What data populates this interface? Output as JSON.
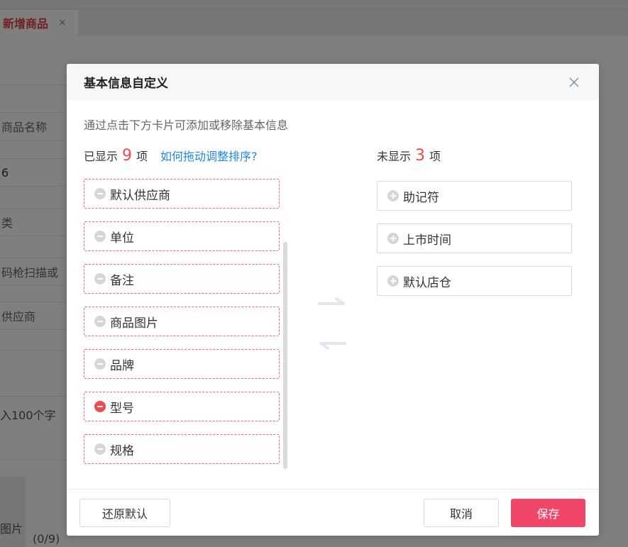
{
  "background": {
    "tab": {
      "label": "新增商品",
      "close": "×"
    },
    "fields": [
      "商品名称",
      "6",
      "类",
      "码枪扫描或",
      "供应商",
      "入100个字",
      "图片"
    ],
    "counter": "(0/9)"
  },
  "modal": {
    "title": "基本信息自定义",
    "description": "通过点击下方卡片可添加或移除基本信息",
    "shown": {
      "label_prefix": "已显示",
      "count": "9",
      "label_suffix": "项",
      "help_link": "如何拖动调整排序?",
      "items": [
        {
          "label": "默认供应商",
          "active": false
        },
        {
          "label": "单位",
          "active": false
        },
        {
          "label": "备注",
          "active": false
        },
        {
          "label": "商品图片",
          "active": false
        },
        {
          "label": "品牌",
          "active": false
        },
        {
          "label": "型号",
          "active": true
        },
        {
          "label": "规格",
          "active": false
        }
      ]
    },
    "hidden": {
      "label_prefix": "未显示",
      "count": "3",
      "label_suffix": "项",
      "items": [
        {
          "label": "助记符"
        },
        {
          "label": "上市时间"
        },
        {
          "label": "默认店仓"
        }
      ]
    },
    "footer": {
      "reset_label": "还原默认",
      "cancel_label": "取消",
      "save_label": "保存"
    }
  },
  "colors": {
    "accent_red": "#f04a4a",
    "save_button": "#f0466a",
    "link_blue": "#1e88e5"
  }
}
